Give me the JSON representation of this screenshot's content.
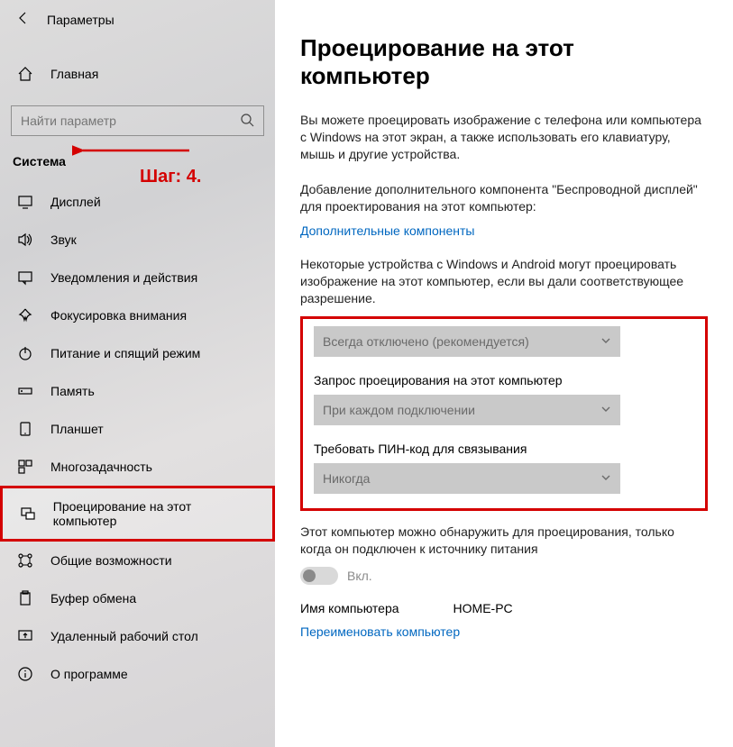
{
  "topbar": {
    "title": "Параметры"
  },
  "home_label": "Главная",
  "search": {
    "placeholder": "Найти параметр"
  },
  "section": "Система",
  "annotation": "Шаг: 4.",
  "sidebar_items": [
    {
      "label": "Дисплей"
    },
    {
      "label": "Звук"
    },
    {
      "label": "Уведомления и действия"
    },
    {
      "label": "Фокусировка внимания"
    },
    {
      "label": "Питание и спящий режим"
    },
    {
      "label": "Память"
    },
    {
      "label": "Планшет"
    },
    {
      "label": "Многозадачность"
    },
    {
      "label": "Проецирование на этот компьютер"
    },
    {
      "label": "Общие возможности"
    },
    {
      "label": "Буфер обмена"
    },
    {
      "label": "Удаленный рабочий стол"
    },
    {
      "label": "О программе"
    }
  ],
  "main": {
    "title": "Проецирование на этот компьютер",
    "p1": "Вы можете проецировать изображение с телефона или компьютера с Windows на этот экран, а также использовать его клавиатуру, мышь и другие устройства.",
    "p2": "Добавление дополнительного компонента \"Беспроводной дисплей\" для проектирования на этот компьютер:",
    "link1": "Дополнительные компоненты",
    "p3": "Некоторые устройства с Windows и Android могут проецировать изображение на этот компьютер, если вы дали соответствующее разрешение.",
    "dd1_value": "Всегда отключено (рекомендуется)",
    "dd2_label": "Запрос проецирования на этот компьютер",
    "dd2_value": "При каждом подключении",
    "dd3_label": "Требовать ПИН-код для связывания",
    "dd3_value": "Никогда",
    "p4": "Этот компьютер можно обнаружить для проецирования, только когда он подключен к источнику питания",
    "toggle_state": "Вкл.",
    "pc_name_label": "Имя компьютера",
    "pc_name_value": "HOME-PC",
    "rename_link": "Переименовать компьютер"
  }
}
